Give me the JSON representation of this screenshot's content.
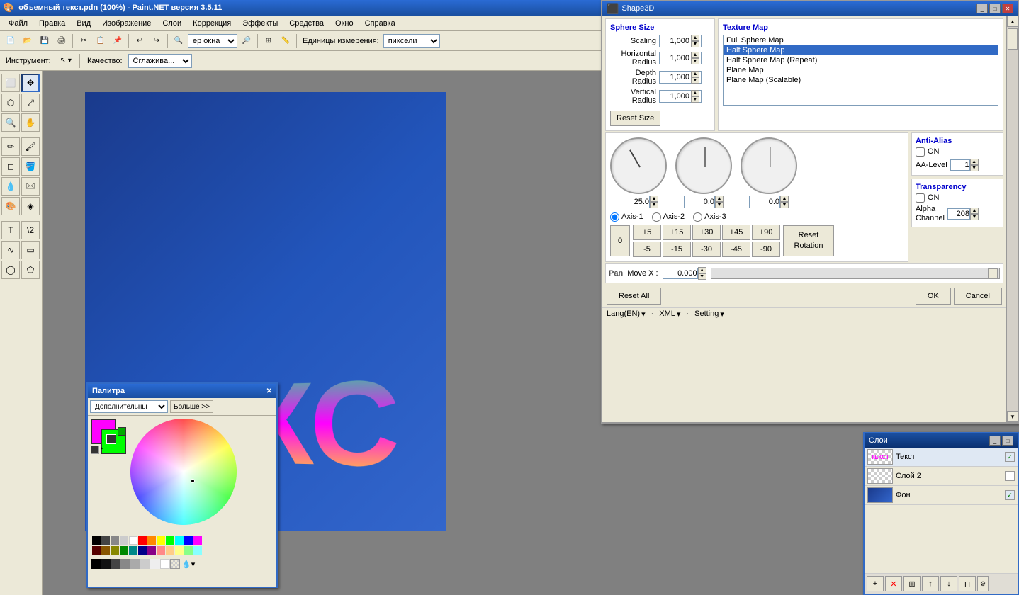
{
  "app": {
    "title": "объемный текст.pdn (100%) - Paint.NET версия 3.5.11",
    "icon": "🎨"
  },
  "menu": {
    "items": [
      "Файл",
      "Правка",
      "Вид",
      "Изображение",
      "Слои",
      "Коррекция",
      "Эффекты",
      "Средства",
      "Окно",
      "Справка"
    ]
  },
  "toolbar": {
    "units_label": "Единицы измерения:",
    "units_value": "пиксели",
    "zoom_value": "ер окна"
  },
  "toolbar2": {
    "tool_label": "Инструмент:",
    "quality_label": "Качество:",
    "quality_value": "Сглажива..."
  },
  "canvas": {
    "text": "ТEКC"
  },
  "palette": {
    "title": "Палитра",
    "mode": "Дополнительны",
    "more_btn": "Больше >>"
  },
  "shape3d": {
    "title": "Shape3D",
    "sphere_size": {
      "label": "Sphere Size",
      "scaling_label": "Scaling",
      "scaling_value": "1,000",
      "horizontal_label": "Horizontal",
      "horizontal_sub": "Radius",
      "horizontal_value": "1,000",
      "depth_label": "Depth",
      "depth_sub": "Radius",
      "depth_value": "1,000",
      "vertical_label": "Vertical",
      "vertical_sub": "Radius",
      "vertical_value": "1,000",
      "reset_btn": "Reset Size"
    },
    "texture_map": {
      "label": "Texture Map",
      "items": [
        "Full Sphere Map",
        "Half Sphere Map",
        "Half Sphere Map (Repeat)",
        "Plane Map",
        "Plane Map (Scalable)"
      ],
      "selected": 1
    },
    "rotation": {
      "axis1_label": "Axis-1",
      "axis2_label": "Axis-2",
      "axis3_label": "Axis-3",
      "dial1_value": "25.0",
      "dial2_value": "0.0",
      "dial3_value": "0.0",
      "btn_labels": [
        "+5",
        "+15",
        "+30",
        "+45",
        "+90",
        "-5",
        "-15",
        "-30",
        "-45",
        "-90"
      ],
      "reset_rotation": "Reset\nRotation",
      "zero_label": "0"
    },
    "anti_alias": {
      "label": "Anti-Alias",
      "on_label": "ON",
      "aa_level_label": "AA-Level",
      "aa_level_value": "1"
    },
    "transparency": {
      "label": "Transparency",
      "on_label": "ON",
      "alpha_label": "Alpha\nChannel",
      "alpha_value": "208"
    },
    "pan": {
      "label": "Pan",
      "move_x_label": "Move X :",
      "move_x_value": "0.000"
    },
    "footer": {
      "reset_all": "Reset All",
      "ok": "OK",
      "cancel": "Cancel"
    },
    "lang_bar": {
      "lang": "Lang(EN)",
      "xml": "XML",
      "setting": "Setting"
    }
  },
  "layers": {
    "items": [
      {
        "name": "Текст",
        "checked": true,
        "type": "text"
      },
      {
        "name": "Слой 2",
        "checked": false,
        "type": "blank"
      },
      {
        "name": "Фон",
        "checked": true,
        "type": "bg"
      }
    ]
  }
}
